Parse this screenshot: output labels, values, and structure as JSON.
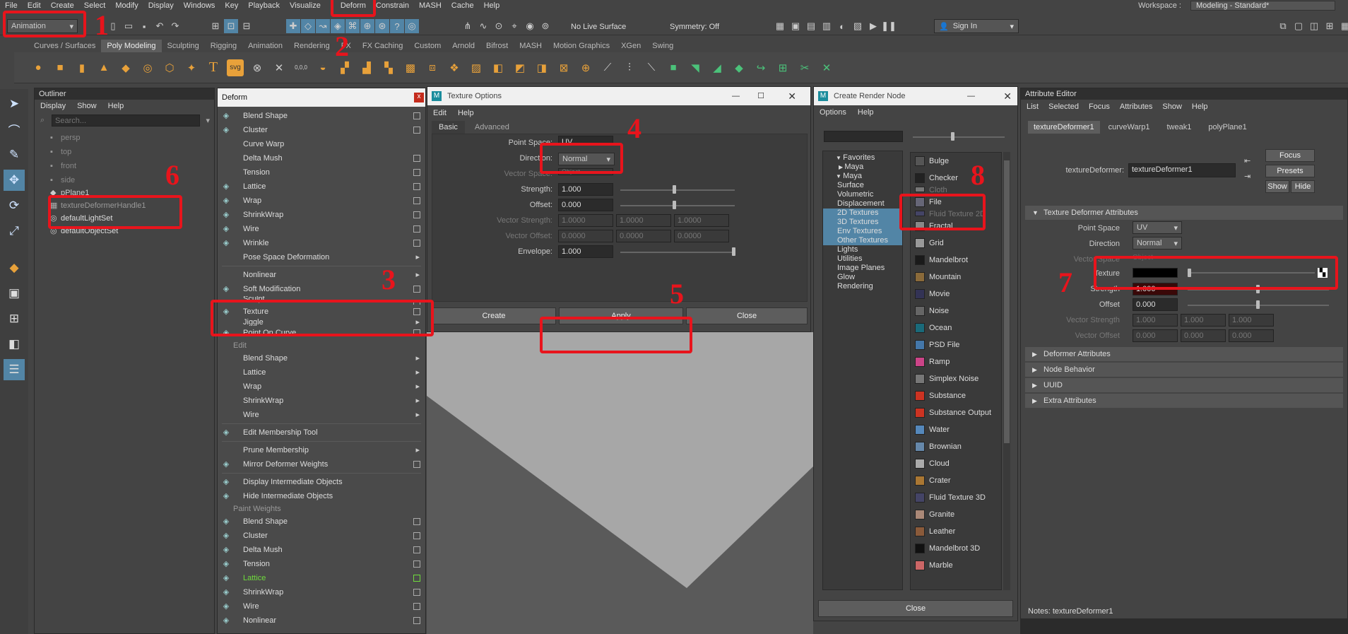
{
  "menubar": {
    "items": [
      "File",
      "Edit",
      "Create",
      "Select",
      "Modify",
      "Display",
      "Windows",
      "Key",
      "Playback",
      "Visualize",
      "Deform",
      "Constrain",
      "MASH",
      "Cache",
      "Help"
    ],
    "workspace_label": "Workspace :",
    "workspace_value": "Modeling - Standard*"
  },
  "statusline": {
    "mode_dropdown": "Animation",
    "live_surface": "No Live Surface",
    "symmetry": "Symmetry: Off",
    "sign_in": "Sign In"
  },
  "shelf": {
    "tabs": [
      "Curves / Surfaces",
      "Poly Modeling",
      "Sculpting",
      "Rigging",
      "Animation",
      "Rendering",
      "FX",
      "FX Caching",
      "Custom",
      "Arnold",
      "Bifrost",
      "MASH",
      "Motion Graphics",
      "XGen",
      "Swing"
    ],
    "active_tab": "Poly Modeling",
    "svg_label": "svg",
    "coord_label": "0,0,0"
  },
  "outliner": {
    "title": "Outliner",
    "menu": [
      "Display",
      "Show",
      "Help"
    ],
    "search_placeholder": "Search...",
    "items": [
      "persp",
      "top",
      "front",
      "side",
      "pPlane1",
      "textureDeformerHandle1",
      "defaultLightSet",
      "defaultObjectSet"
    ]
  },
  "deform_menu": {
    "title": "Deform",
    "close": "x",
    "group1": [
      "Blend Shape",
      "Cluster",
      "Curve Warp",
      "Delta Mush",
      "Tension",
      "Lattice",
      "Wrap",
      "ShrinkWrap",
      "Wire",
      "Wrinkle",
      "Pose Space Deformation"
    ],
    "group2": [
      "Nonlinear",
      "Soft Modification",
      "Sculpt",
      "Texture",
      "Jiggle",
      "Point On Curve"
    ],
    "edit_header": "Edit",
    "edit_items": [
      "Blend Shape",
      "Lattice",
      "Wrap",
      "ShrinkWrap",
      "Wire"
    ],
    "membership": "Edit Membership Tool",
    "prune": "Prune Membership",
    "mirror": "Mirror Deformer Weights",
    "display_inter": "Display Intermediate Objects",
    "hide_inter": "Hide Intermediate Objects",
    "paint_header": "Paint Weights",
    "paint_items": [
      "Blend Shape",
      "Cluster",
      "Delta Mush",
      "Tension",
      "Lattice",
      "ShrinkWrap",
      "Wire",
      "Nonlinear"
    ]
  },
  "texture_options": {
    "title": "Texture Options",
    "menu": [
      "Edit",
      "Help"
    ],
    "tabs": [
      "Basic",
      "Advanced"
    ],
    "point_space_label": "Point Space:",
    "point_space_value": "UV",
    "direction_label": "Direction:",
    "direction_value": "Normal",
    "vector_space_label": "Vector Space:",
    "vector_space_value": "Object",
    "strength_label": "Strength:",
    "strength_value": "1.000",
    "offset_label": "Offset:",
    "offset_value": "0.000",
    "vector_strength_label": "Vector Strength:",
    "vector_strength_values": [
      "1.0000",
      "1.0000",
      "1.0000"
    ],
    "vector_offset_label": "Vector Offset:",
    "vector_offset_values": [
      "0.0000",
      "0.0000",
      "0.0000"
    ],
    "envelope_label": "Envelope:",
    "envelope_value": "1.000",
    "create_btn": "Create",
    "apply_btn": "Apply",
    "close_btn": "Close"
  },
  "render_node": {
    "title": "Create Render Node",
    "menu": [
      "Options",
      "Help"
    ],
    "tree": [
      {
        "label": "Favorites",
        "level": 0,
        "sel": false
      },
      {
        "label": "Maya",
        "level": 1,
        "sel": false
      },
      {
        "label": "Maya",
        "level": 0,
        "sel": false
      },
      {
        "label": "Surface",
        "level": 2,
        "sel": false
      },
      {
        "label": "Volumetric",
        "level": 2,
        "sel": false
      },
      {
        "label": "Displacement",
        "level": 2,
        "sel": false
      },
      {
        "label": "2D Textures",
        "level": 2,
        "sel": true
      },
      {
        "label": "3D Textures",
        "level": 2,
        "sel": true
      },
      {
        "label": "Env Textures",
        "level": 2,
        "sel": true
      },
      {
        "label": "Other Textures",
        "level": 2,
        "sel": true
      },
      {
        "label": "Lights",
        "level": 2,
        "sel": false
      },
      {
        "label": "Utilities",
        "level": 2,
        "sel": false
      },
      {
        "label": "Image Planes",
        "level": 2,
        "sel": false
      },
      {
        "label": "Glow",
        "level": 2,
        "sel": false
      },
      {
        "label": "Rendering",
        "level": 2,
        "sel": false
      }
    ],
    "nodes": [
      {
        "label": "Bulge",
        "color": "#555"
      },
      {
        "label": "Checker",
        "color": "#222"
      },
      {
        "label": "Cloth",
        "color": "#777"
      },
      {
        "label": "File",
        "color": "#667"
      },
      {
        "label": "Fluid Texture 2D",
        "color": "#446"
      },
      {
        "label": "Fractal",
        "color": "#888"
      },
      {
        "label": "Grid",
        "color": "#999"
      },
      {
        "label": "Mandelbrot",
        "color": "#1a1a1a"
      },
      {
        "label": "Mountain",
        "color": "#8a6a3a"
      },
      {
        "label": "Movie",
        "color": "#335"
      },
      {
        "label": "Noise",
        "color": "#666"
      },
      {
        "label": "Ocean",
        "color": "#1a6a7a"
      },
      {
        "label": "PSD File",
        "color": "#4477aa"
      },
      {
        "label": "Ramp",
        "color": "#cc4488"
      },
      {
        "label": "Simplex Noise",
        "color": "#777"
      },
      {
        "label": "Substance",
        "color": "#cc3322"
      },
      {
        "label": "Substance Output",
        "color": "#cc3322"
      },
      {
        "label": "Water",
        "color": "#5588bb"
      },
      {
        "label": "Brownian",
        "color": "#6688aa"
      },
      {
        "label": "Cloud",
        "color": "#aaa"
      },
      {
        "label": "Crater",
        "color": "#aa7733"
      },
      {
        "label": "Fluid Texture 3D",
        "color": "#446"
      },
      {
        "label": "Granite",
        "color": "#a87"
      },
      {
        "label": "Leather",
        "color": "#8a5a3a"
      },
      {
        "label": "Mandelbrot 3D",
        "color": "#111"
      },
      {
        "label": "Marble",
        "color": "#c66"
      }
    ],
    "close_btn": "Close"
  },
  "attribute_editor": {
    "title": "Attribute Editor",
    "menu": [
      "List",
      "Selected",
      "Focus",
      "Attributes",
      "Show",
      "Help"
    ],
    "tabs": [
      "textureDeformer1",
      "curveWarp1",
      "tweak1",
      "polyPlane1"
    ],
    "node_label": "textureDeformer:",
    "node_value": "textureDeformer1",
    "focus_btn": "Focus",
    "presets_btn": "Presets",
    "show_btn": "Show",
    "hide_btn": "Hide",
    "section": "Texture Deformer Attributes",
    "point_space_label": "Point Space",
    "point_space_value": "UV",
    "direction_label": "Direction",
    "direction_value": "Normal",
    "vector_space_label": "Vector Space",
    "vector_space_value": "Object",
    "texture_label": "Texture",
    "strength_label": "Strength",
    "strength_value": "1.000",
    "offset_label": "Offset",
    "offset_value": "0.000",
    "vector_strength_label": "Vector Strength",
    "vector_strength_values": [
      "1.000",
      "1.000",
      "1.000"
    ],
    "vector_offset_label": "Vector Offset",
    "vector_offset_values": [
      "0.000",
      "0.000",
      "0.000"
    ],
    "collapsed": [
      "Deformer Attributes",
      "Node Behavior",
      "UUID",
      "Extra Attributes"
    ],
    "notes": "Notes:  textureDeformer1"
  },
  "annotations": {
    "numbers": [
      "1",
      "2",
      "3",
      "4",
      "5",
      "6",
      "7",
      "8"
    ],
    "color": "#e8141c"
  },
  "colors": {
    "highlight": "#5285a6",
    "lattice_green": "#6fdc3c"
  }
}
